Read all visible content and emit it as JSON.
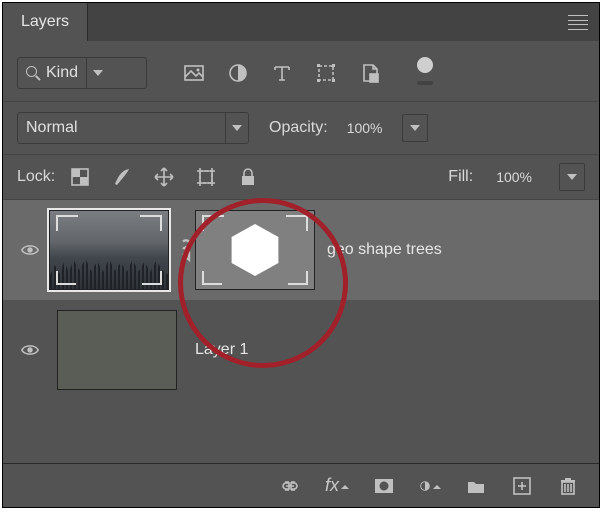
{
  "panel": {
    "title": "Layers"
  },
  "filter": {
    "kind_label": "Kind"
  },
  "blend": {
    "mode_label": "Normal",
    "opacity_label": "Opacity:",
    "opacity_value": "100%"
  },
  "lock": {
    "label": "Lock:",
    "fill_label": "Fill:",
    "fill_value": "100%"
  },
  "layers": [
    {
      "name": "geo shape trees",
      "visible": true,
      "selected": true,
      "has_mask": true,
      "linked": true
    },
    {
      "name": "Layer 1",
      "visible": true,
      "selected": false,
      "has_mask": false,
      "linked": false
    }
  ],
  "bottom": {
    "fx_label": "fx"
  },
  "annotation": {
    "circle_color": "#a12029"
  }
}
